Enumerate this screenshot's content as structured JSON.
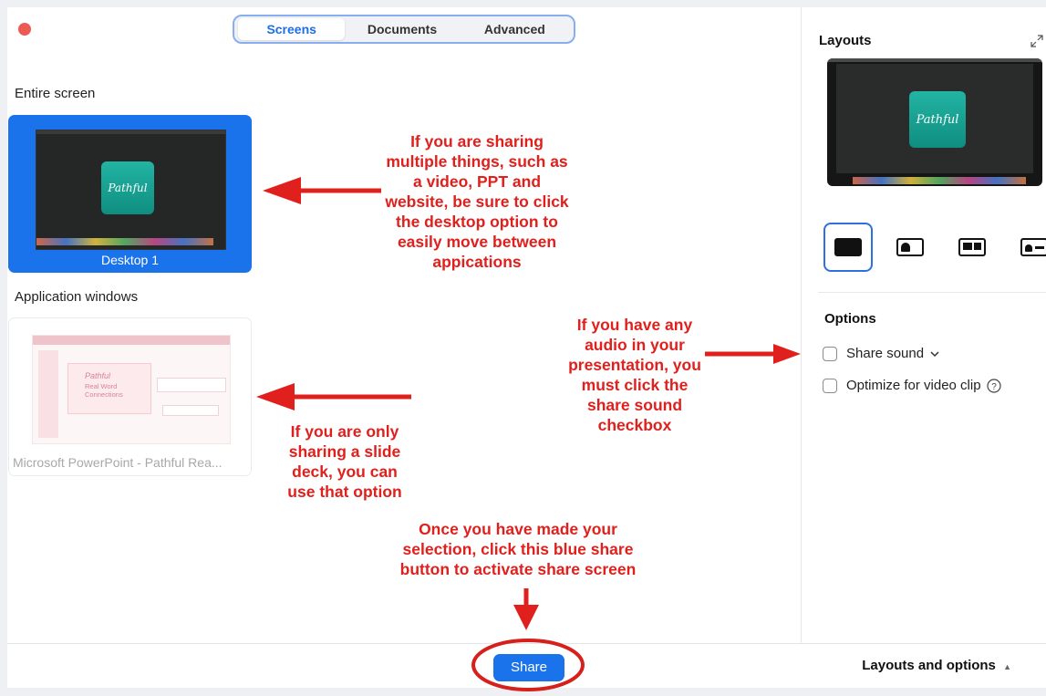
{
  "tabs": [
    {
      "label": "Screens",
      "active": true
    },
    {
      "label": "Documents",
      "active": false
    },
    {
      "label": "Advanced",
      "active": false
    }
  ],
  "main": {
    "entire_screen_label": "Entire screen",
    "desktop_label": "Desktop 1",
    "app_windows_label": "Application windows",
    "ppt_window_label": "Microsoft PowerPoint - Pathful Rea...",
    "slide_title": "Pathful",
    "slide_subtitle": "Real Word Connections",
    "logo_text": "Pathful"
  },
  "annotations": {
    "desktop_note": [
      "If you are sharing",
      "multiple things, such as",
      "a video, PPT and",
      "website, be sure to click",
      "the desktop option to",
      "easily move between",
      "appications"
    ],
    "audio_note": [
      "If you have any",
      "audio in your",
      "presentation, you",
      "must click the",
      "share sound",
      "checkbox"
    ],
    "slide_note": [
      "If you are only",
      "sharing a slide",
      "deck, you can",
      "use that option"
    ],
    "share_note": [
      "Once you have made your",
      "selection, click this blue share",
      "button to activate share screen"
    ],
    "color": "#e0201d"
  },
  "sidebar": {
    "layouts_title": "Layouts",
    "preview_logo": "Pathful",
    "layout_options": [
      "layout-screen-only",
      "layout-screen-camera-left",
      "layout-screen-camera-top",
      "layout-screen-camera-side"
    ],
    "options_title": "Options",
    "share_sound": "Share sound",
    "optimize_video": "Optimize for video clip"
  },
  "footer": {
    "share_label": "Share",
    "layouts_options_label": "Layouts and options"
  },
  "colors": {
    "accent": "#1a73ea",
    "close": "#ec5b53"
  }
}
